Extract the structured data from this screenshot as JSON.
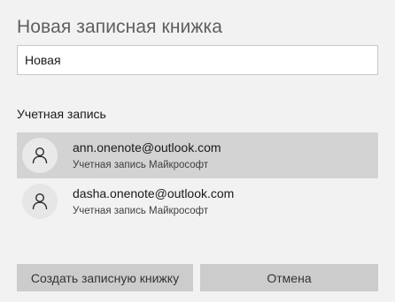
{
  "dialog": {
    "title": "Новая записная книжка"
  },
  "notebook_name": {
    "value": "Новая"
  },
  "account_section": {
    "label": "Учетная запись",
    "accounts": [
      {
        "email": "ann.onenote@outlook.com",
        "type": "Учетная запись Майкрософт",
        "selected": true,
        "icon": "person-icon"
      },
      {
        "email": "dasha.onenote@outlook.com",
        "type": "Учетная запись Майкрософт",
        "selected": false,
        "icon": "person-icon"
      }
    ]
  },
  "buttons": {
    "create_label": "Создать записную книжку",
    "cancel_label": "Отмена"
  },
  "colors": {
    "background": "#f2f2f2",
    "selected_row": "#d3d3d3",
    "button": "#cccccc",
    "avatar": "#e6e6e6"
  }
}
